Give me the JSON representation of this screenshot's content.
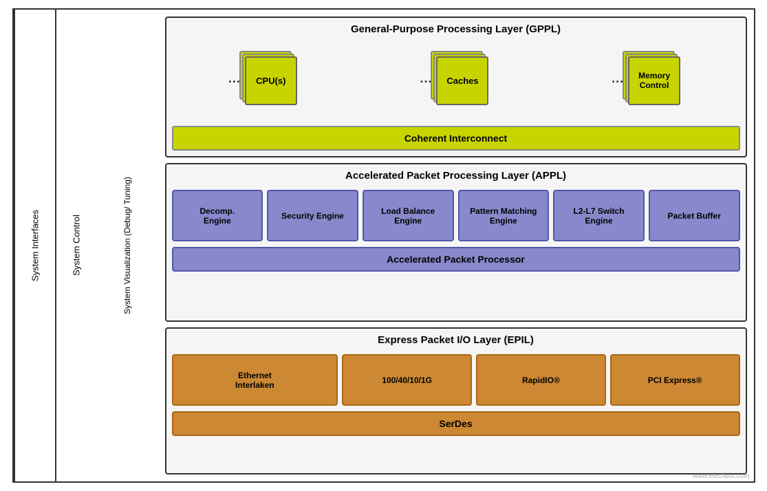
{
  "left_panels": {
    "system_interfaces": "System Interfaces",
    "system_control": "System Control",
    "system_visualization": "System Visualization (Debug/ Tuning)"
  },
  "gppl": {
    "title": "General-Purpose Processing Layer (GPPL)",
    "components": [
      {
        "id": "cpu",
        "label": "CPU(s)",
        "dots": "..."
      },
      {
        "id": "caches",
        "label": "Caches",
        "dots": "..."
      },
      {
        "id": "memory",
        "label": "Memory\nControl",
        "dots": "..."
      }
    ],
    "interconnect": "Coherent Interconnect"
  },
  "appl": {
    "title": "Accelerated Packet Processing Layer (APPL)",
    "engines": [
      {
        "id": "decomp",
        "label": "Decomp.\nEngine"
      },
      {
        "id": "security",
        "label": "Security Engine"
      },
      {
        "id": "load_balance",
        "label": "Load Balance Engine"
      },
      {
        "id": "pattern_matching",
        "label": "Pattern Matching Engine"
      },
      {
        "id": "l2l7",
        "label": "L2-L7 Switch Engine"
      },
      {
        "id": "packet_buffer",
        "label": "Packet Buffer"
      }
    ],
    "processor": "Accelerated Packet Processor"
  },
  "epil": {
    "title": "Express Packet I/O Layer (EPIL)",
    "components": [
      {
        "id": "ethernet",
        "label": "Ethernet\nInterlaken"
      },
      {
        "id": "100g",
        "label": "100/40/10/1G"
      },
      {
        "id": "rapidio",
        "label": "RapidIO®"
      },
      {
        "id": "pci",
        "label": "PCI Express®"
      }
    ],
    "serdes": "SerDes"
  },
  "watermark": "www.elecfans.com"
}
